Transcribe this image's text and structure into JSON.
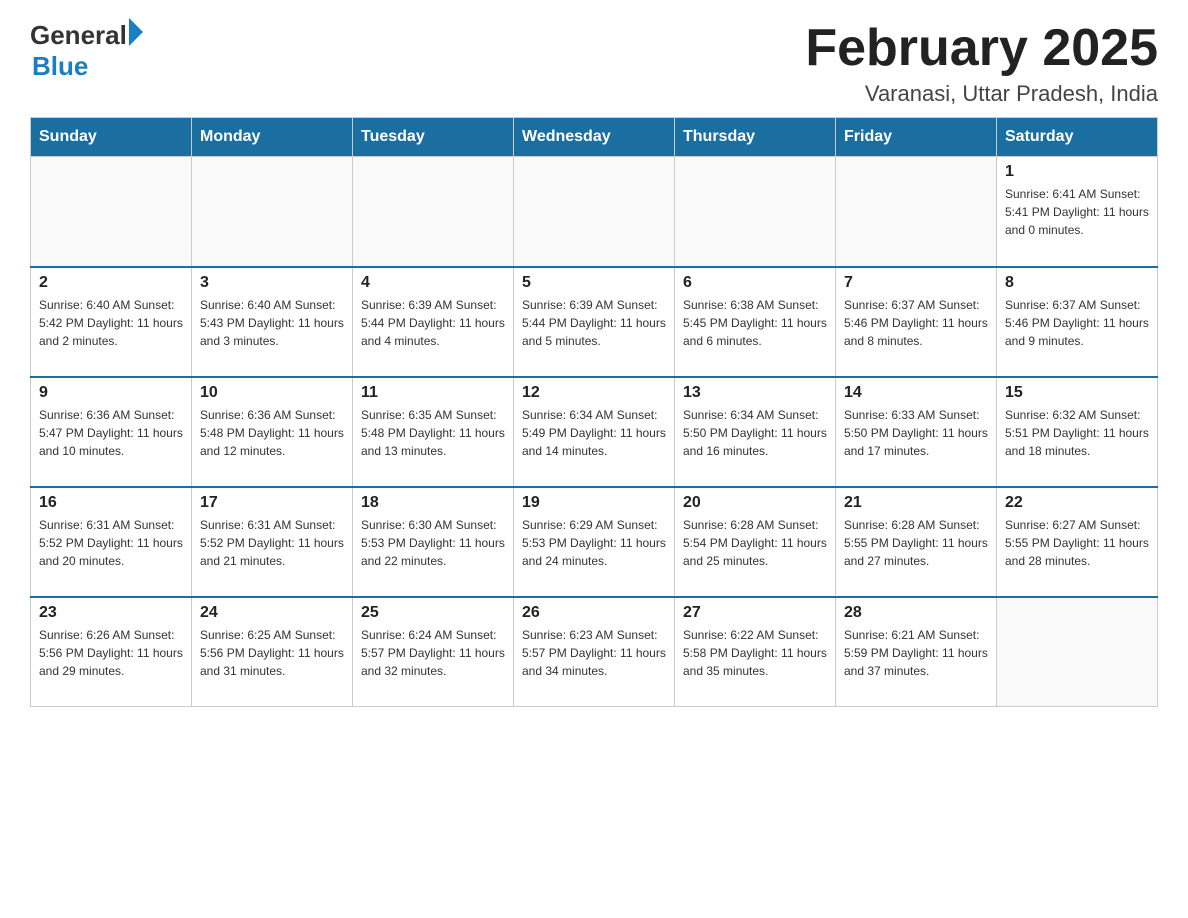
{
  "header": {
    "logo": {
      "general": "General",
      "arrow": "▶",
      "blue": "Blue"
    },
    "title": "February 2025",
    "location": "Varanasi, Uttar Pradesh, India"
  },
  "days_of_week": [
    "Sunday",
    "Monday",
    "Tuesday",
    "Wednesday",
    "Thursday",
    "Friday",
    "Saturday"
  ],
  "weeks": [
    [
      {
        "day": "",
        "info": ""
      },
      {
        "day": "",
        "info": ""
      },
      {
        "day": "",
        "info": ""
      },
      {
        "day": "",
        "info": ""
      },
      {
        "day": "",
        "info": ""
      },
      {
        "day": "",
        "info": ""
      },
      {
        "day": "1",
        "info": "Sunrise: 6:41 AM\nSunset: 5:41 PM\nDaylight: 11 hours and 0 minutes."
      }
    ],
    [
      {
        "day": "2",
        "info": "Sunrise: 6:40 AM\nSunset: 5:42 PM\nDaylight: 11 hours and 2 minutes."
      },
      {
        "day": "3",
        "info": "Sunrise: 6:40 AM\nSunset: 5:43 PM\nDaylight: 11 hours and 3 minutes."
      },
      {
        "day": "4",
        "info": "Sunrise: 6:39 AM\nSunset: 5:44 PM\nDaylight: 11 hours and 4 minutes."
      },
      {
        "day": "5",
        "info": "Sunrise: 6:39 AM\nSunset: 5:44 PM\nDaylight: 11 hours and 5 minutes."
      },
      {
        "day": "6",
        "info": "Sunrise: 6:38 AM\nSunset: 5:45 PM\nDaylight: 11 hours and 6 minutes."
      },
      {
        "day": "7",
        "info": "Sunrise: 6:37 AM\nSunset: 5:46 PM\nDaylight: 11 hours and 8 minutes."
      },
      {
        "day": "8",
        "info": "Sunrise: 6:37 AM\nSunset: 5:46 PM\nDaylight: 11 hours and 9 minutes."
      }
    ],
    [
      {
        "day": "9",
        "info": "Sunrise: 6:36 AM\nSunset: 5:47 PM\nDaylight: 11 hours and 10 minutes."
      },
      {
        "day": "10",
        "info": "Sunrise: 6:36 AM\nSunset: 5:48 PM\nDaylight: 11 hours and 12 minutes."
      },
      {
        "day": "11",
        "info": "Sunrise: 6:35 AM\nSunset: 5:48 PM\nDaylight: 11 hours and 13 minutes."
      },
      {
        "day": "12",
        "info": "Sunrise: 6:34 AM\nSunset: 5:49 PM\nDaylight: 11 hours and 14 minutes."
      },
      {
        "day": "13",
        "info": "Sunrise: 6:34 AM\nSunset: 5:50 PM\nDaylight: 11 hours and 16 minutes."
      },
      {
        "day": "14",
        "info": "Sunrise: 6:33 AM\nSunset: 5:50 PM\nDaylight: 11 hours and 17 minutes."
      },
      {
        "day": "15",
        "info": "Sunrise: 6:32 AM\nSunset: 5:51 PM\nDaylight: 11 hours and 18 minutes."
      }
    ],
    [
      {
        "day": "16",
        "info": "Sunrise: 6:31 AM\nSunset: 5:52 PM\nDaylight: 11 hours and 20 minutes."
      },
      {
        "day": "17",
        "info": "Sunrise: 6:31 AM\nSunset: 5:52 PM\nDaylight: 11 hours and 21 minutes."
      },
      {
        "day": "18",
        "info": "Sunrise: 6:30 AM\nSunset: 5:53 PM\nDaylight: 11 hours and 22 minutes."
      },
      {
        "day": "19",
        "info": "Sunrise: 6:29 AM\nSunset: 5:53 PM\nDaylight: 11 hours and 24 minutes."
      },
      {
        "day": "20",
        "info": "Sunrise: 6:28 AM\nSunset: 5:54 PM\nDaylight: 11 hours and 25 minutes."
      },
      {
        "day": "21",
        "info": "Sunrise: 6:28 AM\nSunset: 5:55 PM\nDaylight: 11 hours and 27 minutes."
      },
      {
        "day": "22",
        "info": "Sunrise: 6:27 AM\nSunset: 5:55 PM\nDaylight: 11 hours and 28 minutes."
      }
    ],
    [
      {
        "day": "23",
        "info": "Sunrise: 6:26 AM\nSunset: 5:56 PM\nDaylight: 11 hours and 29 minutes."
      },
      {
        "day": "24",
        "info": "Sunrise: 6:25 AM\nSunset: 5:56 PM\nDaylight: 11 hours and 31 minutes."
      },
      {
        "day": "25",
        "info": "Sunrise: 6:24 AM\nSunset: 5:57 PM\nDaylight: 11 hours and 32 minutes."
      },
      {
        "day": "26",
        "info": "Sunrise: 6:23 AM\nSunset: 5:57 PM\nDaylight: 11 hours and 34 minutes."
      },
      {
        "day": "27",
        "info": "Sunrise: 6:22 AM\nSunset: 5:58 PM\nDaylight: 11 hours and 35 minutes."
      },
      {
        "day": "28",
        "info": "Sunrise: 6:21 AM\nSunset: 5:59 PM\nDaylight: 11 hours and 37 minutes."
      },
      {
        "day": "",
        "info": ""
      }
    ]
  ]
}
